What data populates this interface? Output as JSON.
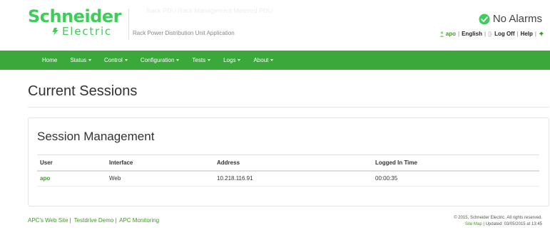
{
  "header": {
    "logo_word1": "Schneider",
    "logo_word2": "Electric",
    "app_name": "Rack Power Distribution Unit Application",
    "faint_title": "Rack PDU  Rack Management  Metered PDU",
    "alarm_status": "No Alarms",
    "alarm_icon": "check-circle-icon",
    "user_name": "apo",
    "language_link": "English",
    "logoff_link": "Log Off",
    "help_link": "Help"
  },
  "nav": {
    "items": [
      {
        "label": "Home",
        "has_dropdown": false
      },
      {
        "label": "Status",
        "has_dropdown": true
      },
      {
        "label": "Control",
        "has_dropdown": true
      },
      {
        "label": "Configuration",
        "has_dropdown": true
      },
      {
        "label": "Tests",
        "has_dropdown": true
      },
      {
        "label": "Logs",
        "has_dropdown": true
      },
      {
        "label": "About",
        "has_dropdown": true
      }
    ]
  },
  "page": {
    "title": "Current Sessions"
  },
  "panel": {
    "title": "Session Management",
    "columns": [
      "User",
      "Interface",
      "Address",
      "Logged In Time"
    ],
    "rows": [
      {
        "user": "apo",
        "interface": "Web",
        "address": "10.218.116.91",
        "logged_in_time": "00:00:35"
      }
    ]
  },
  "footer": {
    "link1": "APC's Web Site",
    "link2": "Testdrive Demo",
    "link3": "APC Monitoring",
    "copyright": "© 2015, Schneider Electric. All rights reserved.",
    "site_map": "Site Map",
    "updated": "Updated: 03/05/2015 at 13:45"
  },
  "colors": {
    "brand_green": "#3dcd58",
    "nav_green": "#3aa83a",
    "link_green": "#3a9d23"
  }
}
